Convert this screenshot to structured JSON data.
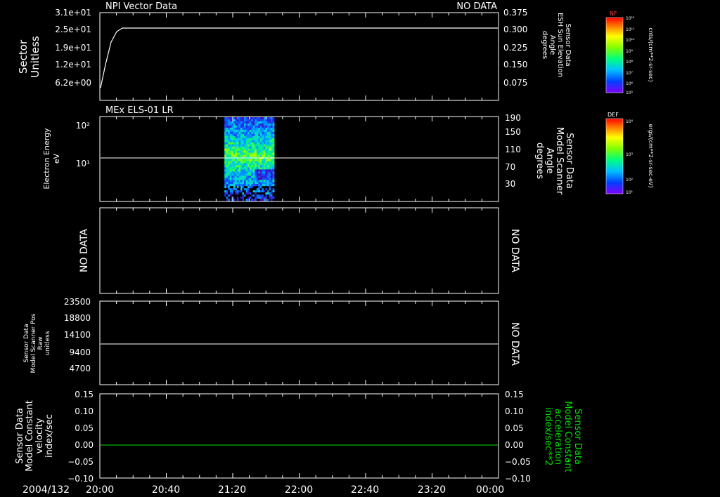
{
  "chart_data": [
    {
      "type": "line",
      "title": "NPI Vector Data",
      "status": "NO DATA",
      "ylabel": [
        "Sector",
        "Unitless"
      ],
      "yticks": [
        "3.1e+01",
        "2.5e+01",
        "1.9e+01",
        "1.2e+01",
        "6.2e+00"
      ],
      "ylabel_right": [
        "Sensor Data",
        "ESH Sun Elevation",
        "Angle",
        "degrees"
      ],
      "yticks_right": [
        "0.375",
        "0.300",
        "0.225",
        "0.150",
        "0.075"
      ],
      "series": [
        {
          "x": [
            "20:00",
            "20:07",
            "20:10",
            "24:00"
          ],
          "values": [
            0,
            18,
            25,
            25
          ]
        }
      ],
      "ylim": [
        0,
        31
      ]
    },
    {
      "type": "heatmap",
      "title": "MEx ELS-01 LR",
      "ylabel": [
        "Electron Energy",
        "eV"
      ],
      "yticks": [
        "10²",
        "10¹"
      ],
      "ylabel_right": [
        "Sensor Data",
        "Model Scanner",
        "Angle",
        "degrees"
      ],
      "yticks_right": [
        "190",
        "150",
        "110",
        "70",
        "30"
      ],
      "data_time_range": [
        "21:15",
        "21:45"
      ],
      "overlay_line_value": 95
    },
    {
      "type": "line",
      "ylabel": [
        "NO DATA"
      ],
      "status_right": "NO DATA"
    },
    {
      "type": "line",
      "ylabel": [
        "Sensor Data",
        "Model Scanner Pos",
        "Raw",
        "unitless"
      ],
      "yticks": [
        "23500",
        "18800",
        "14100",
        "9400",
        "4700"
      ],
      "status_right": "NO DATA",
      "series": [
        {
          "x": [
            "20:00",
            "24:00"
          ],
          "values": [
            11600,
            11600
          ]
        }
      ],
      "ylim": [
        0,
        23500
      ]
    },
    {
      "type": "line",
      "ylabel": [
        "Sensor Data",
        "Model Constant",
        "velocity",
        "index/sec"
      ],
      "yticks": [
        "0.15",
        "0.10",
        "0.05",
        "0.00",
        "−0.05",
        "−0.10"
      ],
      "ylabel_right": [
        "Sensor Data",
        "Model Constant",
        "acceleration",
        "index/sec**2"
      ],
      "yticks_right": [
        "0.15",
        "0.10",
        "0.05",
        "0.00",
        "−0.05",
        "−0.10"
      ],
      "series": [
        {
          "x": [
            "20:00",
            "24:00"
          ],
          "values": [
            0,
            0
          ],
          "color": "#00e000"
        }
      ],
      "ylim": [
        -0.1,
        0.15
      ]
    }
  ],
  "time_axis": {
    "date": "2004/132",
    "labels": [
      "20:00",
      "20:40",
      "21:20",
      "22:00",
      "22:40",
      "23:20",
      "00:00"
    ]
  },
  "colorbars": [
    {
      "name": "NF",
      "units": "cnts/(cm**2-sr-sec)",
      "ticks": [
        "10¹²",
        "10¹¹",
        "10¹⁰",
        "10⁹",
        "10⁸",
        "10⁷",
        "10⁶",
        "10⁵"
      ]
    },
    {
      "name": "DEF",
      "units": "ergs/(cm**2-sr-sec-eV)",
      "ticks": [
        "10⁴",
        "10³",
        "10²",
        "10¹"
      ]
    }
  ],
  "colors": {
    "background": "#000000",
    "foreground": "#ffffff",
    "accent_green": "#00e000"
  }
}
